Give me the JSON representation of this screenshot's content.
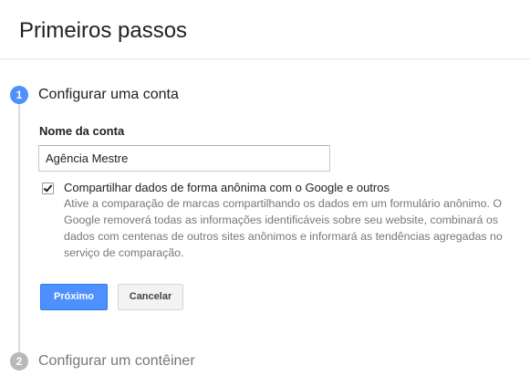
{
  "header": {
    "title": "Primeiros passos"
  },
  "steps": [
    {
      "number": "1",
      "title": "Configurar uma conta"
    },
    {
      "number": "2",
      "title": "Configurar um contêiner"
    }
  ],
  "account_form": {
    "name_label": "Nome da conta",
    "name_value": "Agência Mestre",
    "share_checkbox": {
      "checked": true,
      "label": "Compartilhar dados de forma anônima com o Google e outros",
      "description": "Ative a comparação de marcas compartilhando os dados em um formulário anônimo. O Google removerá todas as informações identificáveis sobre seu website, combinará os dados com centenas de outros sites anônimos e informará as tendências agregadas no serviço de comparação."
    },
    "next_label": "Próximo",
    "cancel_label": "Cancelar"
  },
  "colors": {
    "accent": "#4d90fe",
    "step_inactive": "#b9b9b9",
    "muted_text": "#777777"
  }
}
